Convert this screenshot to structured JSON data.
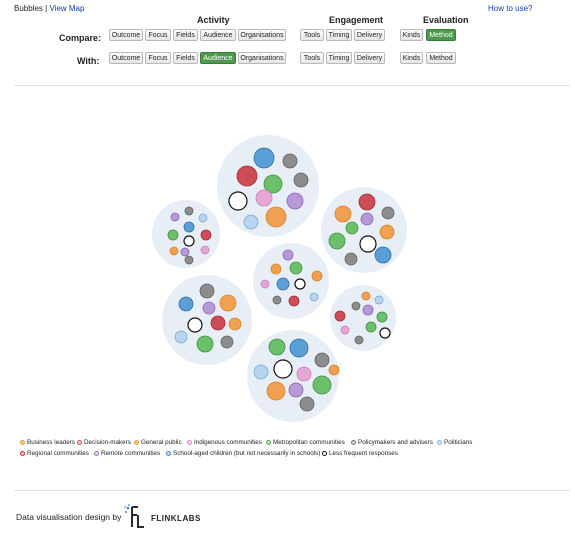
{
  "nav": {
    "current": "Bubbles",
    "separator": "|",
    "link": "View Map",
    "help": "How to use?"
  },
  "groups": {
    "activity": "Activity",
    "engagement": "Engagement",
    "evaluation": "Evaluation"
  },
  "compare": {
    "label": "Compare:",
    "buttons": [
      "Outcome",
      "Focus",
      "Fields",
      "Audience",
      "Organisations",
      "Tools",
      "Timing",
      "Delivery",
      "Kinds",
      "Method"
    ],
    "selected": "Method"
  },
  "with": {
    "label": "With:",
    "buttons": [
      "Outcome",
      "Focus",
      "Fields",
      "Audience",
      "Organisations",
      "Tools",
      "Timing",
      "Delivery",
      "Kinds",
      "Method"
    ],
    "selected": "Audience"
  },
  "colors": {
    "business": "#f2b46a",
    "decision": "#cf4b56",
    "general": "#f0a050",
    "indigenous": "#e6a6d6",
    "metropolitan": "#6cc06c",
    "policy": "#8c8c8c",
    "politicians": "#b8d4ee",
    "regional": "#d44a52",
    "remote": "#b899d8",
    "school": "#5a9fd6",
    "less": "#ffffff",
    "group_bg": "#e8eef6",
    "accent_selected": "#4d9a4d"
  },
  "legend": [
    {
      "label": "Business leaders",
      "color": "#f4c27a",
      "stroke": "#e0a64c"
    },
    {
      "label": "Decision-makers",
      "color": "#f3d1c4",
      "stroke": "#c0504d"
    },
    {
      "label": "General public",
      "color": "#f7c58a",
      "stroke": "#ee9a3c"
    },
    {
      "label": "Indigenous communities",
      "color": "#f4d5ee",
      "stroke": "#d88ac9"
    },
    {
      "label": "Metropolitan communities",
      "color": "#c9e9c9",
      "stroke": "#4ea74e"
    },
    {
      "label": "Policymakers and advisers",
      "color": "#d3d3d3",
      "stroke": "#777777"
    },
    {
      "label": "Politicians",
      "color": "#d5e6f5",
      "stroke": "#8fb8e0"
    },
    {
      "label": "Regional communities",
      "color": "#f4b9bd",
      "stroke": "#c8303c"
    },
    {
      "label": "Remote communities",
      "color": "#e1d3f0",
      "stroke": "#9b74c8"
    },
    {
      "label": "School-aged children (but not necessarily in schools)",
      "color": "#cbe1f4",
      "stroke": "#3f86c6"
    },
    {
      "label": "Less frequent responses",
      "color": "#ffffff",
      "stroke": "#111111"
    }
  ],
  "footer": {
    "credit": "Data visualisation design by",
    "brand": "FLINKLABS"
  }
}
